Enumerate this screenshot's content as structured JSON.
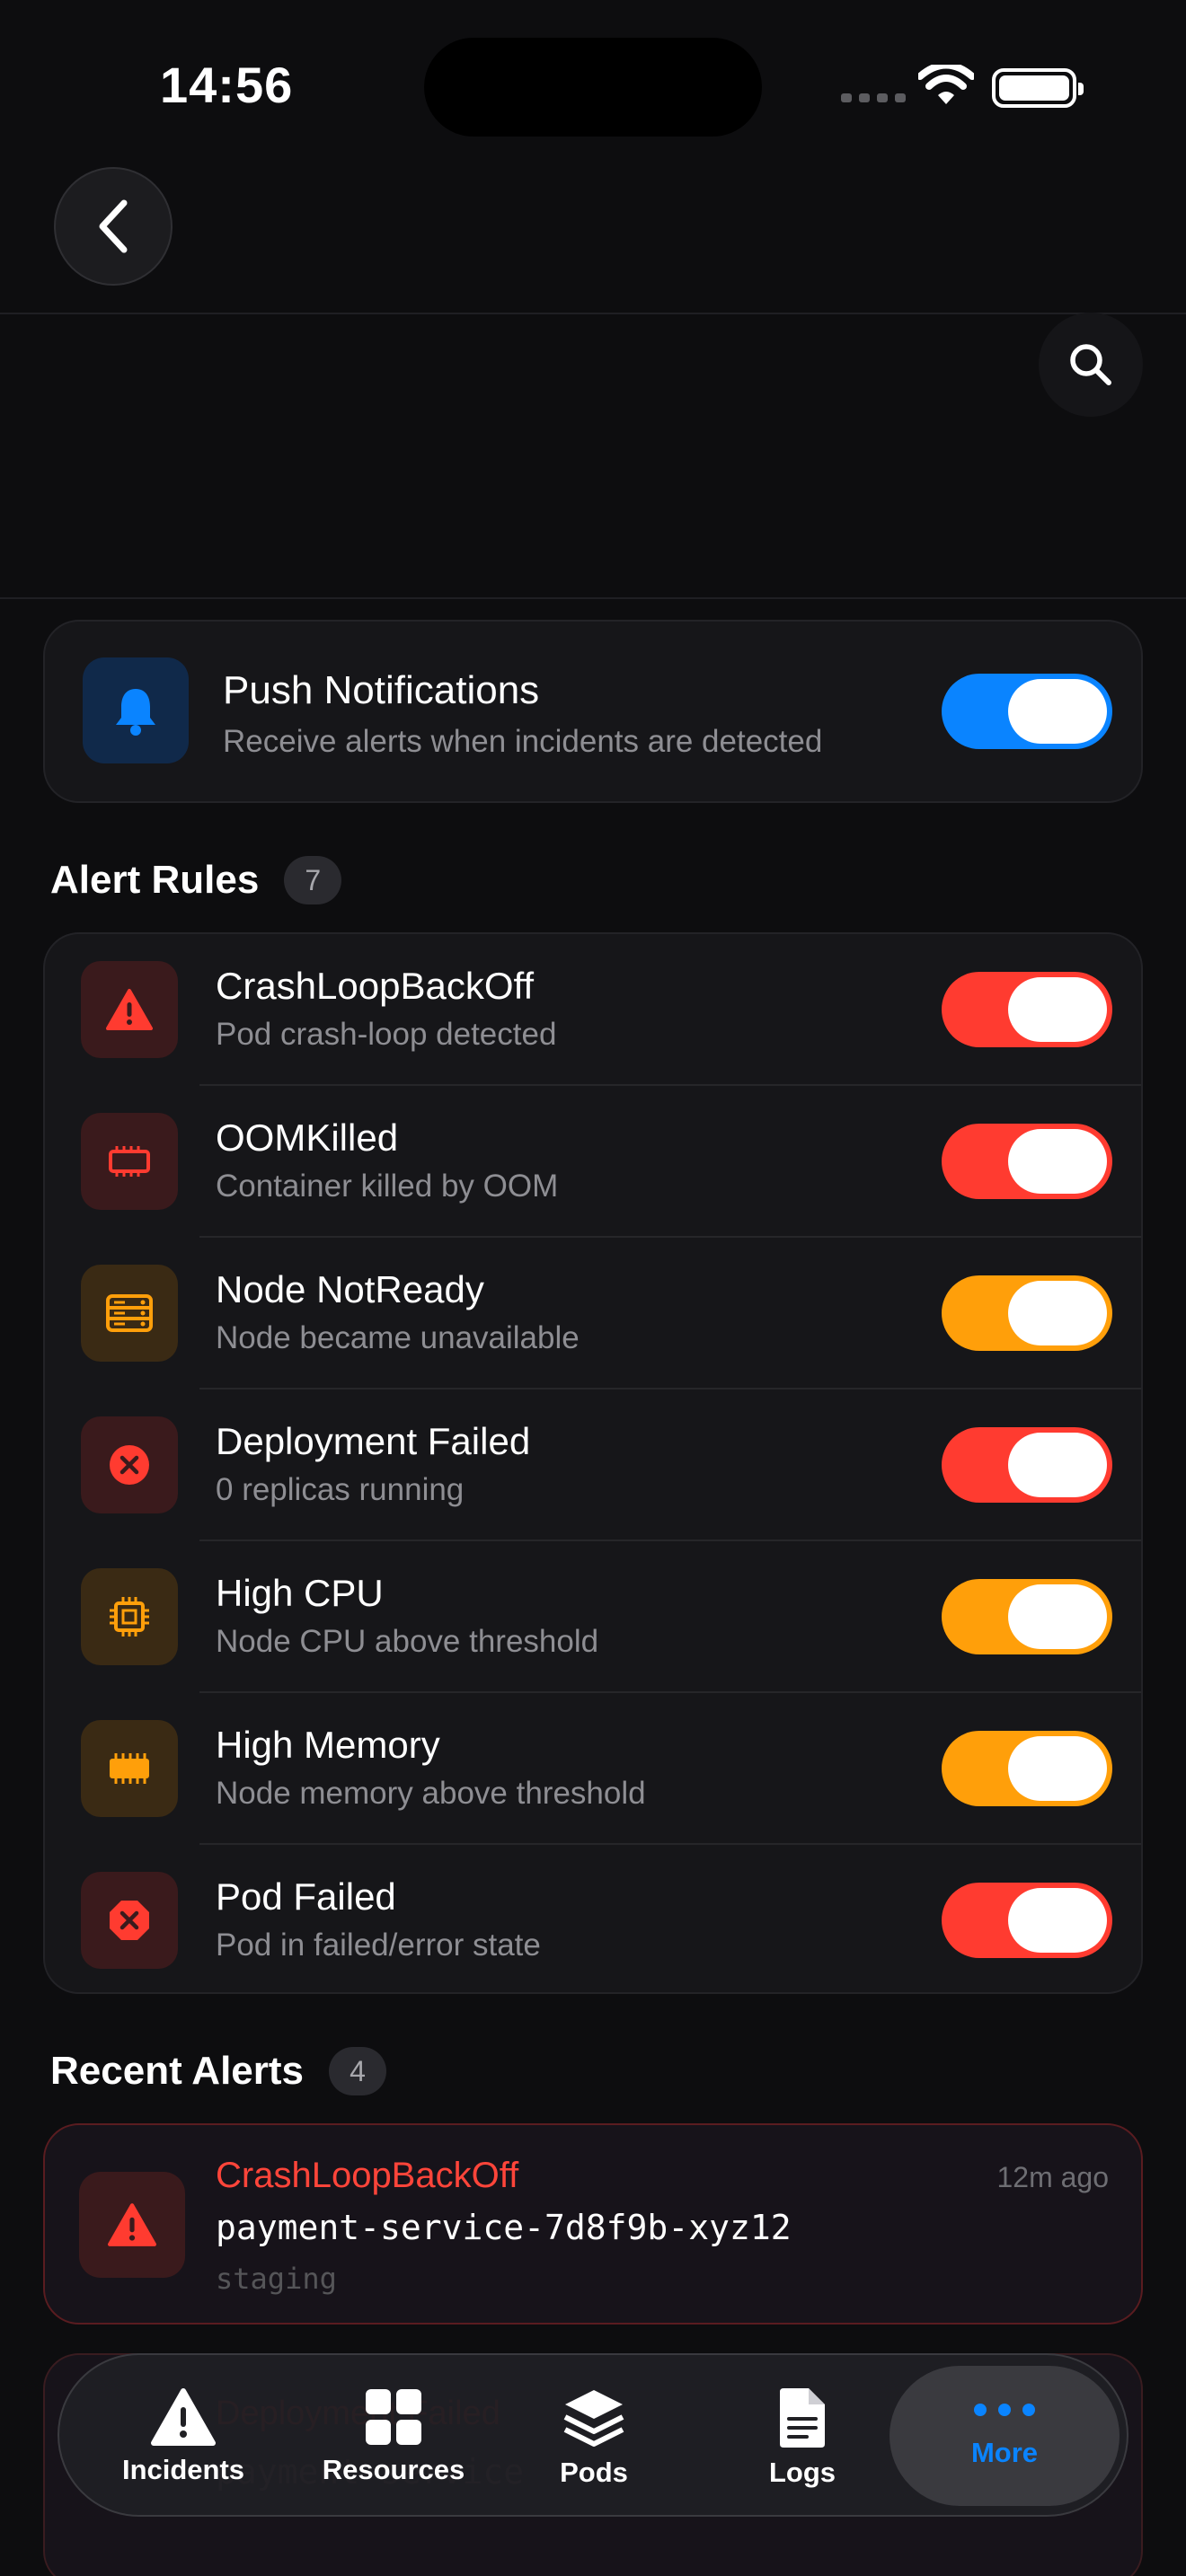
{
  "status_bar": {
    "time": "14:56"
  },
  "push": {
    "title": "Push Notifications",
    "subtitle": "Receive alerts when incidents are detected",
    "enabled": true
  },
  "alert_rules": {
    "title": "Alert Rules",
    "count": "7",
    "items": [
      {
        "title": "CrashLoopBackOff",
        "subtitle": "Pod crash-loop detected",
        "icon": "warning-triangle-icon",
        "color": "#ff3b30",
        "enabled": true
      },
      {
        "title": "OOMKilled",
        "subtitle": "Container killed by OOM",
        "icon": "memory-chip-icon",
        "color": "#ff3b30",
        "enabled": true
      },
      {
        "title": "Node NotReady",
        "subtitle": "Node became unavailable",
        "icon": "server-icon",
        "color": "#ff9f0a",
        "enabled": true
      },
      {
        "title": "Deployment Failed",
        "subtitle": "0 replicas running",
        "icon": "x-circle-icon",
        "color": "#ff3b30",
        "enabled": true
      },
      {
        "title": "High CPU",
        "subtitle": "Node CPU above threshold",
        "icon": "cpu-icon",
        "color": "#ff9f0a",
        "enabled": true
      },
      {
        "title": "High Memory",
        "subtitle": "Node memory above threshold",
        "icon": "memory-icon",
        "color": "#ff9f0a",
        "enabled": true
      },
      {
        "title": "Pod Failed",
        "subtitle": "Pod in failed/error state",
        "icon": "x-octagon-icon",
        "color": "#ff3b30",
        "enabled": true
      }
    ]
  },
  "recent_alerts": {
    "title": "Recent Alerts",
    "count": "4",
    "items": [
      {
        "type": "CrashLoopBackOff",
        "time": "12m ago",
        "pod": "payment-service-7d8f9b-xyz12",
        "namespace": "staging"
      },
      {
        "type": "Deployment Failed",
        "pod": "payment-service"
      }
    ]
  },
  "tabbar": {
    "items": [
      {
        "label": "Incidents",
        "icon": "warning-icon"
      },
      {
        "label": "Resources",
        "icon": "grid-icon"
      },
      {
        "label": "Pods",
        "icon": "layers-icon"
      },
      {
        "label": "Logs",
        "icon": "document-icon"
      },
      {
        "label": "More",
        "icon": "ellipsis-icon",
        "active": true
      }
    ]
  },
  "colors": {
    "accent": "#0a84ff",
    "critical": "#ff3b30",
    "warning": "#ff9f0a"
  }
}
